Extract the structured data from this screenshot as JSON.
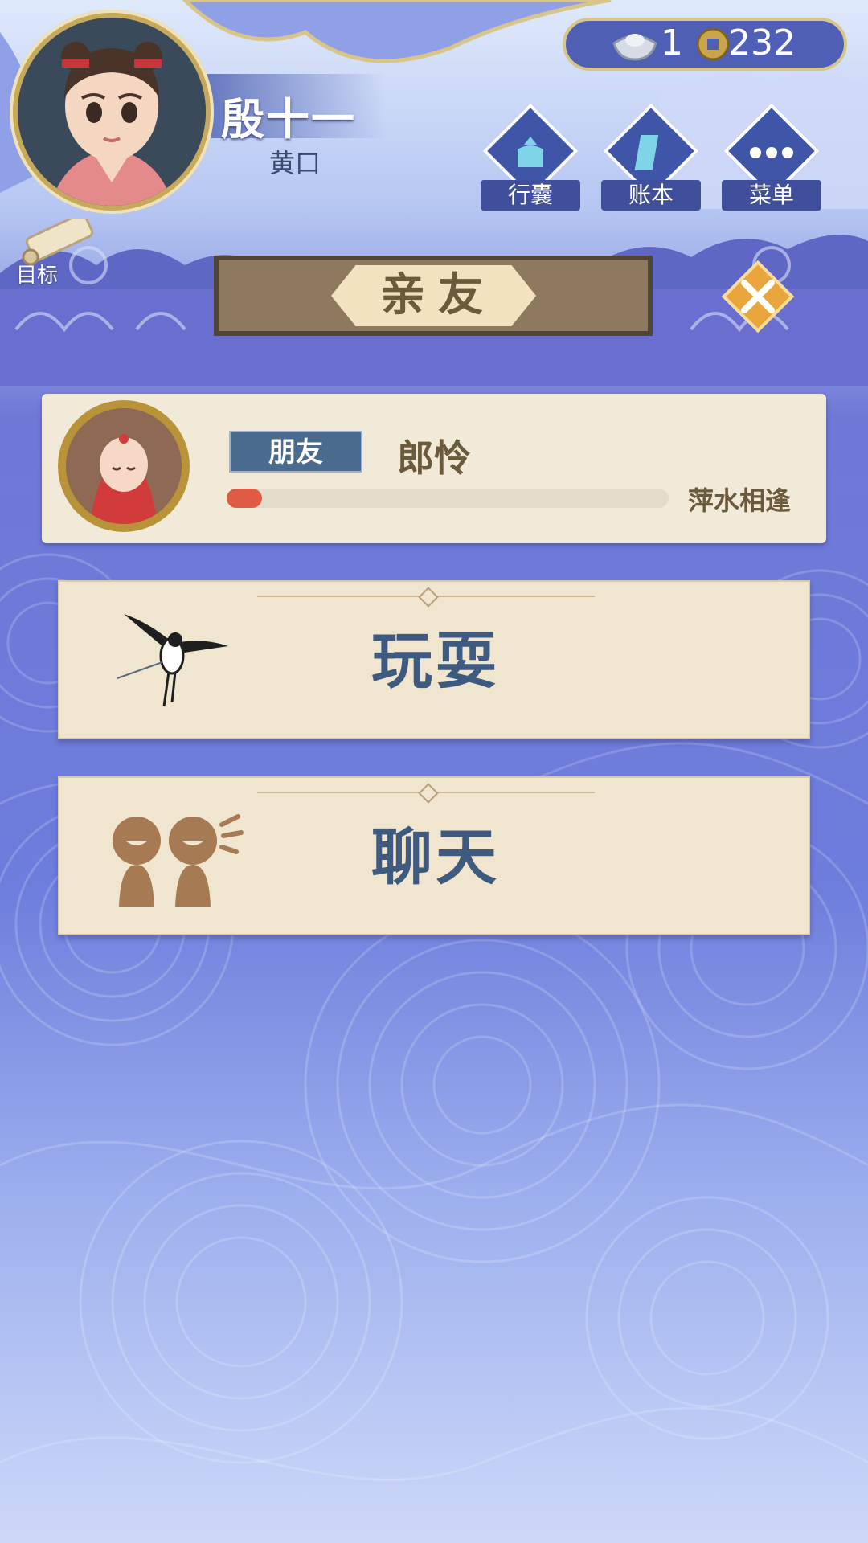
{
  "player": {
    "name": "殷十一",
    "rank": "黄口",
    "goal_label": "目标"
  },
  "currency": {
    "silver": "1",
    "coins": "232"
  },
  "top_menu": [
    {
      "label": "行囊",
      "icon": "bundle-icon"
    },
    {
      "label": "账本",
      "icon": "ledger-icon"
    },
    {
      "label": "菜单",
      "icon": "more-icon"
    }
  ],
  "panel": {
    "title": "亲友"
  },
  "friend": {
    "relation": "朋友",
    "name": "郎怜",
    "bond_level": "萍水相逢",
    "bond_progress": 0.08
  },
  "actions": [
    {
      "label": "玩耍",
      "icon": "swallow-kite-icon"
    },
    {
      "label": "聊天",
      "icon": "chat-people-icon"
    }
  ],
  "colors": {
    "accent": "#3e5a7e",
    "progress": "#e05b46",
    "card": "#f0e5cf",
    "text_brown": "#6b5a3c"
  }
}
